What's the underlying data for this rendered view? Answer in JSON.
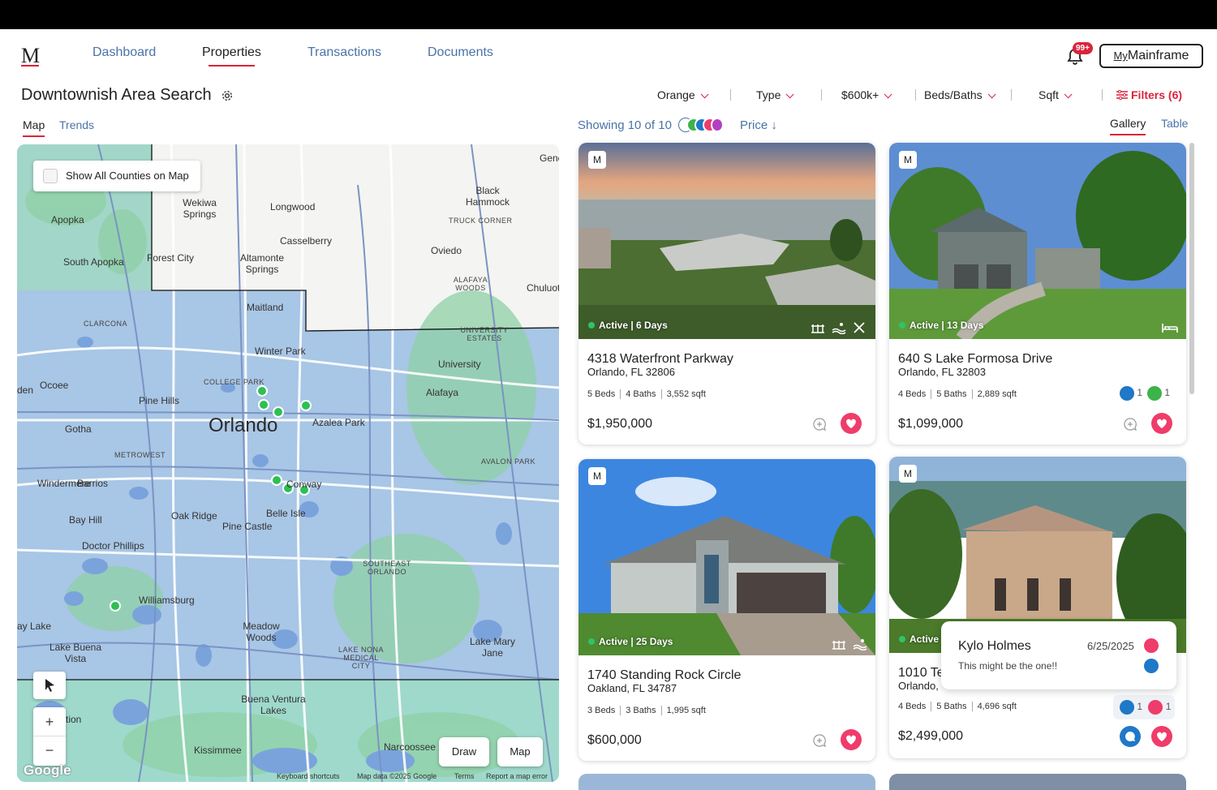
{
  "logo": "M",
  "nav": {
    "links": [
      "Dashboard",
      "Properties",
      "Transactions",
      "Documents"
    ],
    "notification_badge": "99+",
    "account_button_prefix": "My",
    "account_button": "Mainframe"
  },
  "search": {
    "title": "Downtownish Area Search"
  },
  "filters": {
    "county": "Orange",
    "type": "Type",
    "price": "$600k+",
    "beds_baths": "Beds/Baths",
    "sqft": "Sqft",
    "more": "Filters (6)"
  },
  "left_tabs": [
    "Map",
    "Trends"
  ],
  "right_tabs": [
    "Gallery",
    "Table"
  ],
  "results": {
    "showing": "Showing 10 of 10",
    "sort": "Price"
  },
  "map": {
    "show_all": "Show All Counties on Map",
    "draw": "Draw",
    "map_type": "Map",
    "zoom_in": "+",
    "zoom_out": "−",
    "google": "Google",
    "footer": [
      "Keyboard shortcuts",
      "Map data ©2025 Google",
      "Terms",
      "Report a map error"
    ],
    "places": [
      "Gene",
      "Black Hammock",
      "Wekiwa Springs",
      "Longwood",
      "TRUCK CORNER",
      "Apopka",
      "Casselberry",
      "Oviedo",
      "Forest City",
      "Altamonte Springs",
      "South Apopka",
      "ALAFAYA WOODS",
      "Chuluot",
      "Maitland",
      "CLARCONA",
      "UNIVERSITY ESTATES",
      "Winter Park",
      "University",
      "COLLEGE PARK",
      "Ocoee",
      "den",
      "Pine Hills",
      "Alafaya",
      "Orlando",
      "Azalea Park",
      "Gotha",
      "METROWEST",
      "AVALON PARK",
      "Windermere",
      "Barrios",
      "Conway",
      "Bay Hill",
      "Oak Ridge",
      "Belle Isle",
      "Pine Castle",
      "Doctor Phillips",
      "SOUTHEAST ORLANDO",
      "Williamsburg",
      "ay Lake",
      "Meadow Woods",
      "Lake Mary Jane",
      "Lake Buena Vista",
      "LAKE NONA MEDICAL CITY",
      "tion",
      "Buena Ventura Lakes",
      "Kissimmee",
      "Narcoossee"
    ]
  },
  "listings": [
    {
      "badge": "M",
      "status": "Active | 6 Days",
      "address": "4318 Waterfront Parkway",
      "city": "Orlando, FL 32806",
      "beds": "5 Beds",
      "baths": "4 Baths",
      "sqft": "3,552 sqft",
      "price": "$1,950,000",
      "amenities": [
        "dock-icon",
        "pool-icon",
        "kitchen-icon"
      ]
    },
    {
      "badge": "M",
      "status": "Active | 13 Days",
      "address": "640 S Lake Formosa Drive",
      "city": "Orlando, FL 32803",
      "beds": "4 Beds",
      "baths": "5 Baths",
      "sqft": "2,889 sqft",
      "price": "$1,099,000",
      "comment_count": "1",
      "like_count": "1",
      "amenities": [
        "bed-icon"
      ]
    },
    {
      "badge": "M",
      "status": "Active | 25 Days",
      "address": "1740 Standing Rock Circle",
      "city": "Oakland, FL 34787",
      "beds": "3 Beds",
      "baths": "3 Baths",
      "sqft": "1,995 sqft",
      "price": "$600,000",
      "amenities": [
        "dock-icon",
        "pool-icon"
      ]
    },
    {
      "badge": "M",
      "status": "Active",
      "address": "1010 Ter",
      "city": "Orlando,",
      "beds": "4 Beds",
      "baths": "5 Baths",
      "sqft": "4,696 sqft",
      "price": "$2,499,000",
      "comment_count": "1",
      "heart_count": "1"
    }
  ],
  "popup": {
    "name": "Kylo Holmes",
    "date": "6/25/2025",
    "message": "This might be the one!!"
  },
  "colors": {
    "accent": "#d9243b",
    "link": "#4a73a8",
    "heart": "#f03c6a",
    "comment": "#1f78c8",
    "like": "#3db34a"
  }
}
